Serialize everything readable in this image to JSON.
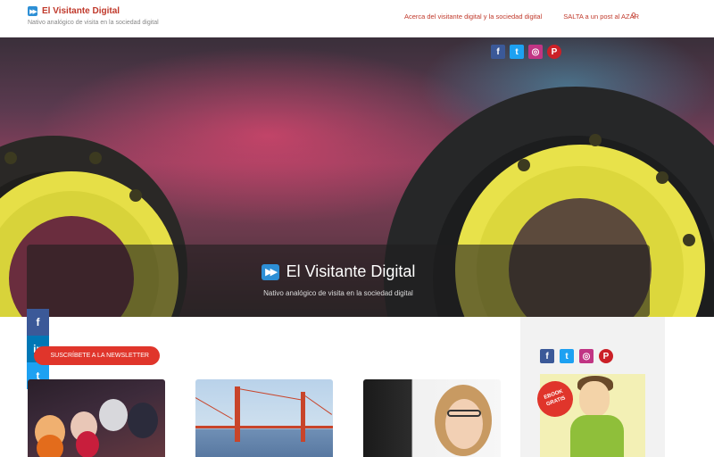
{
  "header": {
    "site_title": "El Visitante Digital",
    "tagline": "Nativo analógico de visita en la sociedad digital",
    "nav": [
      {
        "label": "Acerca del visitante digital y la sociedad digital"
      },
      {
        "label": "SALTA a un post al AZAR"
      }
    ],
    "logo_icon": "fast-forward-icon",
    "search_icon": "search-icon"
  },
  "hero": {
    "title": "El Visitante Digital",
    "subtitle": "Nativo analógico de visita en la sociedad digital",
    "social": [
      {
        "name": "facebook",
        "glyph": "f"
      },
      {
        "name": "twitter",
        "glyph": "t"
      },
      {
        "name": "instagram",
        "glyph": "◎"
      },
      {
        "name": "pinterest",
        "glyph": "P"
      }
    ]
  },
  "share_bar": [
    {
      "name": "facebook",
      "glyph": "f"
    },
    {
      "name": "linkedin",
      "glyph": "in"
    },
    {
      "name": "twitter",
      "glyph": "t"
    }
  ],
  "newsletter": {
    "label": "SUSCRÍBETE A LA NEWSLETTER"
  },
  "sidebar": {
    "social": [
      {
        "name": "facebook",
        "glyph": "f"
      },
      {
        "name": "twitter",
        "glyph": "t"
      },
      {
        "name": "instagram",
        "glyph": "◎"
      },
      {
        "name": "pinterest",
        "glyph": "P"
      }
    ],
    "ebook_badge": "EBOOK GRATIS"
  },
  "colors": {
    "accent": "#c0392b",
    "newsletter_button": "#e0352b",
    "logo_blue": "#2d8fd5",
    "facebook": "#3b5998",
    "twitter": "#1da1f2",
    "linkedin": "#0077b5"
  }
}
